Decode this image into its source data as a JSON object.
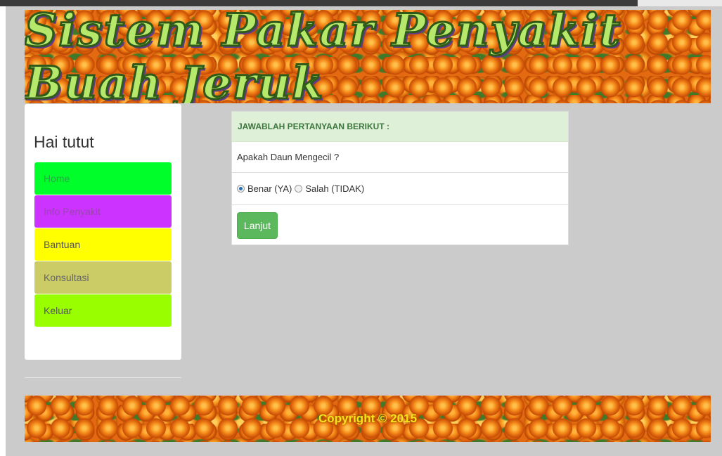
{
  "header": {
    "title": "Sistem Pakar Penyakit Buah Jeruk"
  },
  "sidebar": {
    "greeting": "Hai tutut",
    "menu": [
      {
        "label": "Home",
        "bg": "#00ff2a",
        "color": "#2aa34a"
      },
      {
        "label": "Info Penyakit",
        "bg": "#cc33ff",
        "color": "#9a44b0"
      },
      {
        "label": "Bantuan",
        "bg": "#ffff00",
        "color": "#555555"
      },
      {
        "label": "Konsultasi",
        "bg": "#cccc66",
        "color": "#666666"
      },
      {
        "label": "Keluar",
        "bg": "#99ff00",
        "color": "#555555"
      }
    ]
  },
  "panel": {
    "heading": "JAWABLAH PERTANYAAN BERIKUT :",
    "question": "Apakah Daun Mengecil ?",
    "options": [
      {
        "label": "Benar (YA)",
        "checked": true
      },
      {
        "label": "Salah (TIDAK)",
        "checked": false
      }
    ],
    "submit_label": "Lanjut"
  },
  "footer": {
    "text": "Copyright © 2015"
  }
}
